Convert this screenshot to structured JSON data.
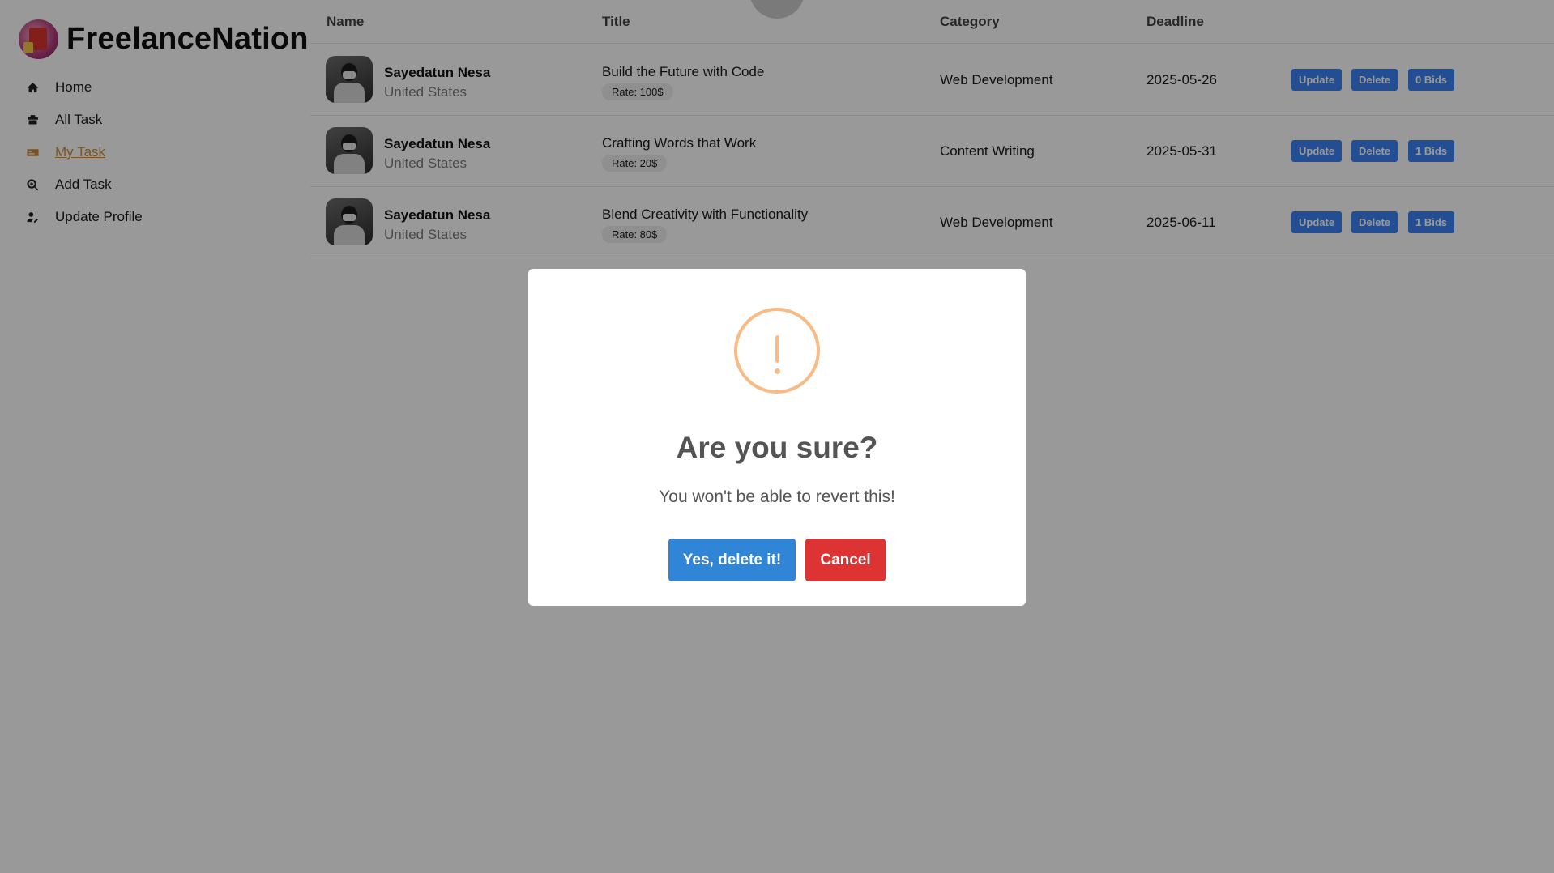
{
  "brand": {
    "name": "FreelanceNation"
  },
  "sidebar": {
    "items": [
      {
        "label": "Home",
        "icon": "home-icon"
      },
      {
        "label": "All Task",
        "icon": "tasks-icon"
      },
      {
        "label": "My Task",
        "icon": "my-task-icon",
        "active": true
      },
      {
        "label": "Add Task",
        "icon": "search-plus-icon"
      },
      {
        "label": "Update Profile",
        "icon": "user-edit-icon"
      }
    ]
  },
  "table": {
    "headers": {
      "name": "Name",
      "title": "Title",
      "category": "Category",
      "deadline": "Deadline"
    },
    "rows": [
      {
        "name": "Sayedatun Nesa",
        "country": "United States",
        "title": "Build the Future with Code",
        "rate": "Rate: 100$",
        "category": "Web Development",
        "deadline": "2025-05-26",
        "update": "Update",
        "delete": "Delete",
        "bids": "0 Bids"
      },
      {
        "name": "Sayedatun Nesa",
        "country": "United States",
        "title": "Crafting Words that Work",
        "rate": "Rate: 20$",
        "category": "Content Writing",
        "deadline": "2025-05-31",
        "update": "Update",
        "delete": "Delete",
        "bids": "1 Bids"
      },
      {
        "name": "Sayedatun Nesa",
        "country": "United States",
        "title": "Blend Creativity with Functionality",
        "rate": "Rate: 80$",
        "category": "Web Development",
        "deadline": "2025-06-11",
        "update": "Update",
        "delete": "Delete",
        "bids": "1 Bids"
      }
    ]
  },
  "modal": {
    "icon": "warning-icon",
    "title": "Are you sure?",
    "text": "You won't be able to revert this!",
    "confirm": "Yes, delete it!",
    "cancel": "Cancel"
  },
  "colors": {
    "accent": "#3085d6",
    "danger": "#dd3333",
    "warning": "#f8bb86",
    "active_nav": "#c98a3e",
    "action_button": "#3b82f6"
  }
}
